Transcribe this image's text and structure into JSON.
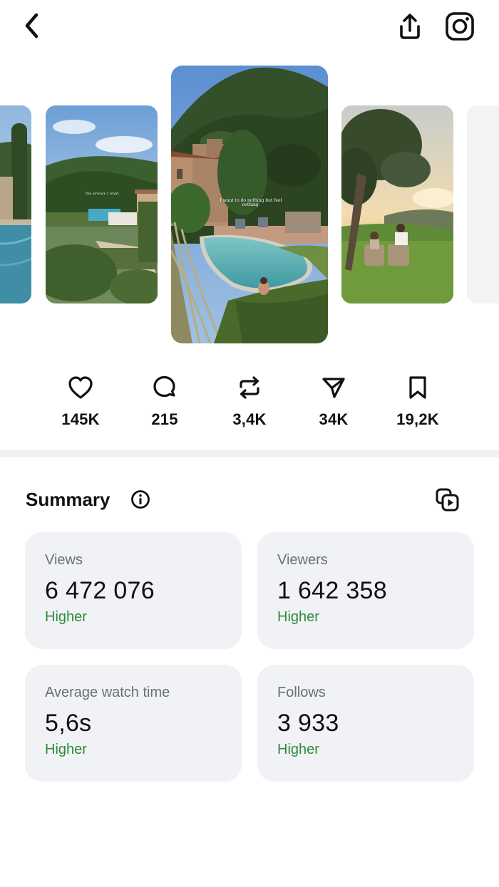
{
  "header": {
    "back_icon": "chevron-left-icon",
    "share_icon": "share-upload-icon",
    "platform_icon": "instagram-icon"
  },
  "carousel": {
    "items": [
      {
        "caption": ""
      },
      {
        "caption": "the privacy I want."
      },
      {
        "caption": "I want to do nothing but feel nothing."
      },
      {
        "caption": ""
      },
      {
        "caption": ""
      }
    ]
  },
  "stats": [
    {
      "icon": "heart-icon",
      "value": "145K"
    },
    {
      "icon": "comment-icon",
      "value": "215"
    },
    {
      "icon": "repost-icon",
      "value": "3,4K"
    },
    {
      "icon": "send-icon",
      "value": "34K"
    },
    {
      "icon": "bookmark-icon",
      "value": "19,2K"
    }
  ],
  "summary": {
    "title": "Summary",
    "info_icon": "info-icon",
    "copy_icon": "copy-video-icon",
    "cards": [
      {
        "label": "Views",
        "value": "6 472 076",
        "trend": "Higher"
      },
      {
        "label": "Viewers",
        "value": "1 642 358",
        "trend": "Higher"
      },
      {
        "label": "Average watch time",
        "value": "5,6s",
        "trend": "Higher"
      },
      {
        "label": "Follows",
        "value": "3 933",
        "trend": "Higher"
      }
    ]
  },
  "colors": {
    "trend_positive": "#2e8b3e",
    "card_bg": "#f1f2f5",
    "divider": "#f0f1f4"
  }
}
